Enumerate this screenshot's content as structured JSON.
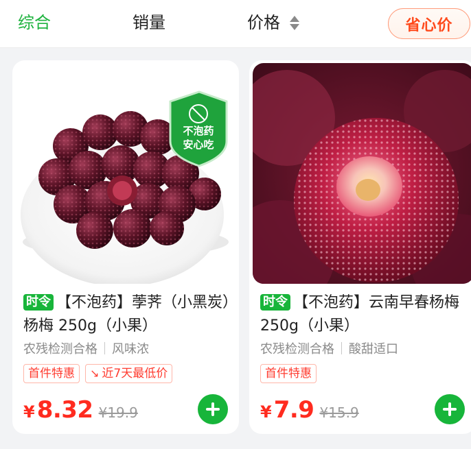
{
  "sort_bar": {
    "tabs": [
      {
        "label": "综合",
        "active": true
      },
      {
        "label": "销量",
        "active": false
      },
      {
        "label": "价格",
        "active": false
      }
    ],
    "saver_button": "省心价"
  },
  "products": [
    {
      "season_tag": "时令",
      "title": "【不泡药】荸荠（小黑炭）杨梅 250g（小果）",
      "badge_line1": "不泡药",
      "badge_line2": "安心吃",
      "features": [
        "农残检测合格",
        "风味浓"
      ],
      "tags": [
        "首件特惠",
        "近7天最低价"
      ],
      "currency": "¥",
      "price": "8.32",
      "original_price": "¥19.9"
    },
    {
      "season_tag": "时令",
      "title": "【不泡药】云南早春杨梅250g（小果）",
      "features": [
        "农残检测合格",
        "酸甜适口"
      ],
      "tags": [
        "首件特惠"
      ],
      "currency": "¥",
      "price": "7.9",
      "original_price": "¥15.9"
    }
  ],
  "colors": {
    "brand_green": "#17b53a",
    "price_red": "#ff2b1f",
    "saver_orange": "#ff4a1c"
  }
}
